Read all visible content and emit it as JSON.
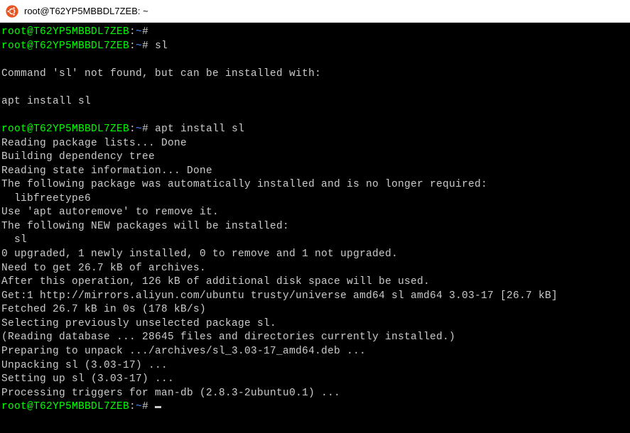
{
  "window": {
    "title": "root@T62YP5MBBDL7ZEB: ~"
  },
  "prompt": {
    "user_host": "root@T62YP5MBBDL7ZEB",
    "colon": ":",
    "path": "~",
    "symbol": "#"
  },
  "lines": [
    {
      "type": "prompt",
      "cmd": ""
    },
    {
      "type": "prompt",
      "cmd": "sl"
    },
    {
      "type": "blank"
    },
    {
      "type": "output",
      "text": "Command 'sl' not found, but can be installed with:"
    },
    {
      "type": "blank"
    },
    {
      "type": "output",
      "text": "apt install sl"
    },
    {
      "type": "blank"
    },
    {
      "type": "prompt",
      "cmd": "apt install sl"
    },
    {
      "type": "output",
      "text": "Reading package lists... Done"
    },
    {
      "type": "output",
      "text": "Building dependency tree"
    },
    {
      "type": "output",
      "text": "Reading state information... Done"
    },
    {
      "type": "output",
      "text": "The following package was automatically installed and is no longer required:"
    },
    {
      "type": "output",
      "text": "  libfreetype6"
    },
    {
      "type": "output",
      "text": "Use 'apt autoremove' to remove it."
    },
    {
      "type": "output",
      "text": "The following NEW packages will be installed:"
    },
    {
      "type": "output",
      "text": "  sl"
    },
    {
      "type": "output",
      "text": "0 upgraded, 1 newly installed, 0 to remove and 1 not upgraded."
    },
    {
      "type": "output",
      "text": "Need to get 26.7 kB of archives."
    },
    {
      "type": "output",
      "text": "After this operation, 126 kB of additional disk space will be used."
    },
    {
      "type": "output",
      "text": "Get:1 http://mirrors.aliyun.com/ubuntu trusty/universe amd64 sl amd64 3.03-17 [26.7 kB]"
    },
    {
      "type": "output",
      "text": "Fetched 26.7 kB in 0s (178 kB/s)"
    },
    {
      "type": "output",
      "text": "Selecting previously unselected package sl."
    },
    {
      "type": "output",
      "text": "(Reading database ... 28645 files and directories currently installed.)"
    },
    {
      "type": "output",
      "text": "Preparing to unpack .../archives/sl_3.03-17_amd64.deb ..."
    },
    {
      "type": "output",
      "text": "Unpacking sl (3.03-17) ..."
    },
    {
      "type": "output",
      "text": "Setting up sl (3.03-17) ..."
    },
    {
      "type": "output",
      "text": "Processing triggers for man-db (2.8.3-2ubuntu0.1) ..."
    },
    {
      "type": "prompt_cursor",
      "cmd": ""
    }
  ]
}
